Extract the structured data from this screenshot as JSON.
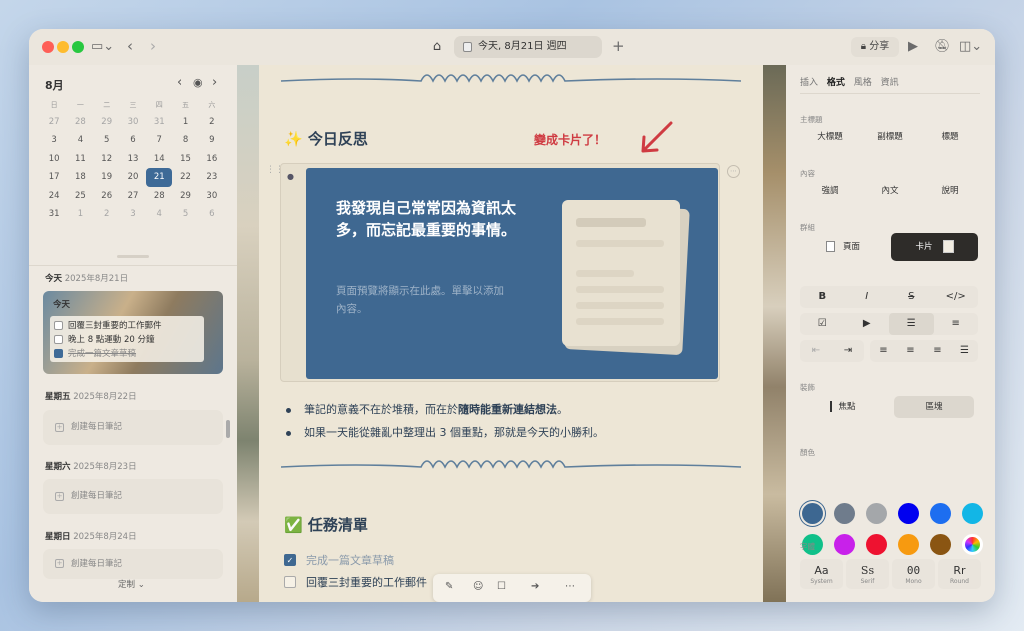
{
  "toolbar": {
    "tab_title": "今天, 8月21日 週四",
    "share_label": "分享"
  },
  "calendar": {
    "month": "8月",
    "weekdays": [
      "日",
      "一",
      "二",
      "三",
      "四",
      "五",
      "六"
    ],
    "weeks": [
      [
        "27",
        "28",
        "29",
        "30",
        "31",
        "1",
        "2"
      ],
      [
        "3",
        "4",
        "5",
        "6",
        "7",
        "8",
        "9"
      ],
      [
        "10",
        "11",
        "12",
        "13",
        "14",
        "15",
        "16"
      ],
      [
        "17",
        "18",
        "19",
        "20",
        "21",
        "22",
        "23"
      ],
      [
        "24",
        "25",
        "26",
        "27",
        "28",
        "29",
        "30"
      ],
      [
        "31",
        "1",
        "2",
        "3",
        "4",
        "5",
        "6"
      ]
    ],
    "selected_day": "21"
  },
  "sidebar": {
    "today_heading": "今天",
    "today_date": "2025年8月21日",
    "today_card_label": "今天",
    "today_tasks": [
      {
        "text": "回覆三封重要的工作郵件",
        "done": false
      },
      {
        "text": "晚上 8 點運動 20 分鐘",
        "done": false
      },
      {
        "text": "完成一篇文章草稿",
        "done": true
      }
    ],
    "days": [
      {
        "weekday": "星期五",
        "date": "2025年8月22日",
        "action": "創建每日筆記"
      },
      {
        "weekday": "星期六",
        "date": "2025年8月23日",
        "action": "創建每日筆記"
      },
      {
        "weekday": "星期日",
        "date": "2025年8月24日",
        "action": "創建每日筆記"
      }
    ],
    "customize_label": "定制 ⌄"
  },
  "editor": {
    "reflection_heading": "✨ 今日反思",
    "annotation": "變成卡片了！",
    "card_title": "我發現自己常常因為資訊太多，而忘記最重要的事情。",
    "card_placeholder": "頁面預覽將顯示在此處。單擊以添加內容。",
    "bullet1_pre": "筆記的意義不在於堆積，而在於",
    "bullet1_bold": "隨時能重新連結想法",
    "bullet1_post": "。",
    "bullet2": "如果一天能從雜亂中整理出 3 個重點，那就是今天的小勝利。",
    "tasks_heading": "✅ 任務清單",
    "tasks": [
      {
        "text": "完成一篇文章草稿",
        "done": true
      },
      {
        "text": "回覆三封重要的工作郵件",
        "done": false
      }
    ]
  },
  "panel": {
    "tabs": [
      "插入",
      "格式",
      "風格",
      "資訊"
    ],
    "active_tab": "格式",
    "headings_label": "主標題",
    "heading_buttons": [
      "大標題",
      "副標題",
      "標題"
    ],
    "content_label": "內容",
    "content_buttons": [
      "強調",
      "內文",
      "說明"
    ],
    "group_label": "群組",
    "group_page": "頁面",
    "group_card": "卡片",
    "format_row1": [
      "B",
      "I",
      "S",
      "</>"
    ],
    "indent_label": "裝飾",
    "focus_label": "焦點",
    "block_label": "區塊",
    "color_label": "顏色",
    "colors": [
      "#3d6791",
      "#6f7c8c",
      "#a4a7aa",
      "#0000f0",
      "#1d6ef0",
      "#12b6e6",
      "#10c089",
      "#c821ea",
      "#ee1230",
      "#f79a10",
      "#8a5512",
      "#2a2a2a"
    ],
    "font_label": "字體",
    "fonts": [
      {
        "glyph": "Aa",
        "name": "System"
      },
      {
        "glyph": "Ss",
        "name": "Serif"
      },
      {
        "glyph": "00",
        "name": "Mono"
      },
      {
        "glyph": "Rr",
        "name": "Round"
      }
    ]
  }
}
